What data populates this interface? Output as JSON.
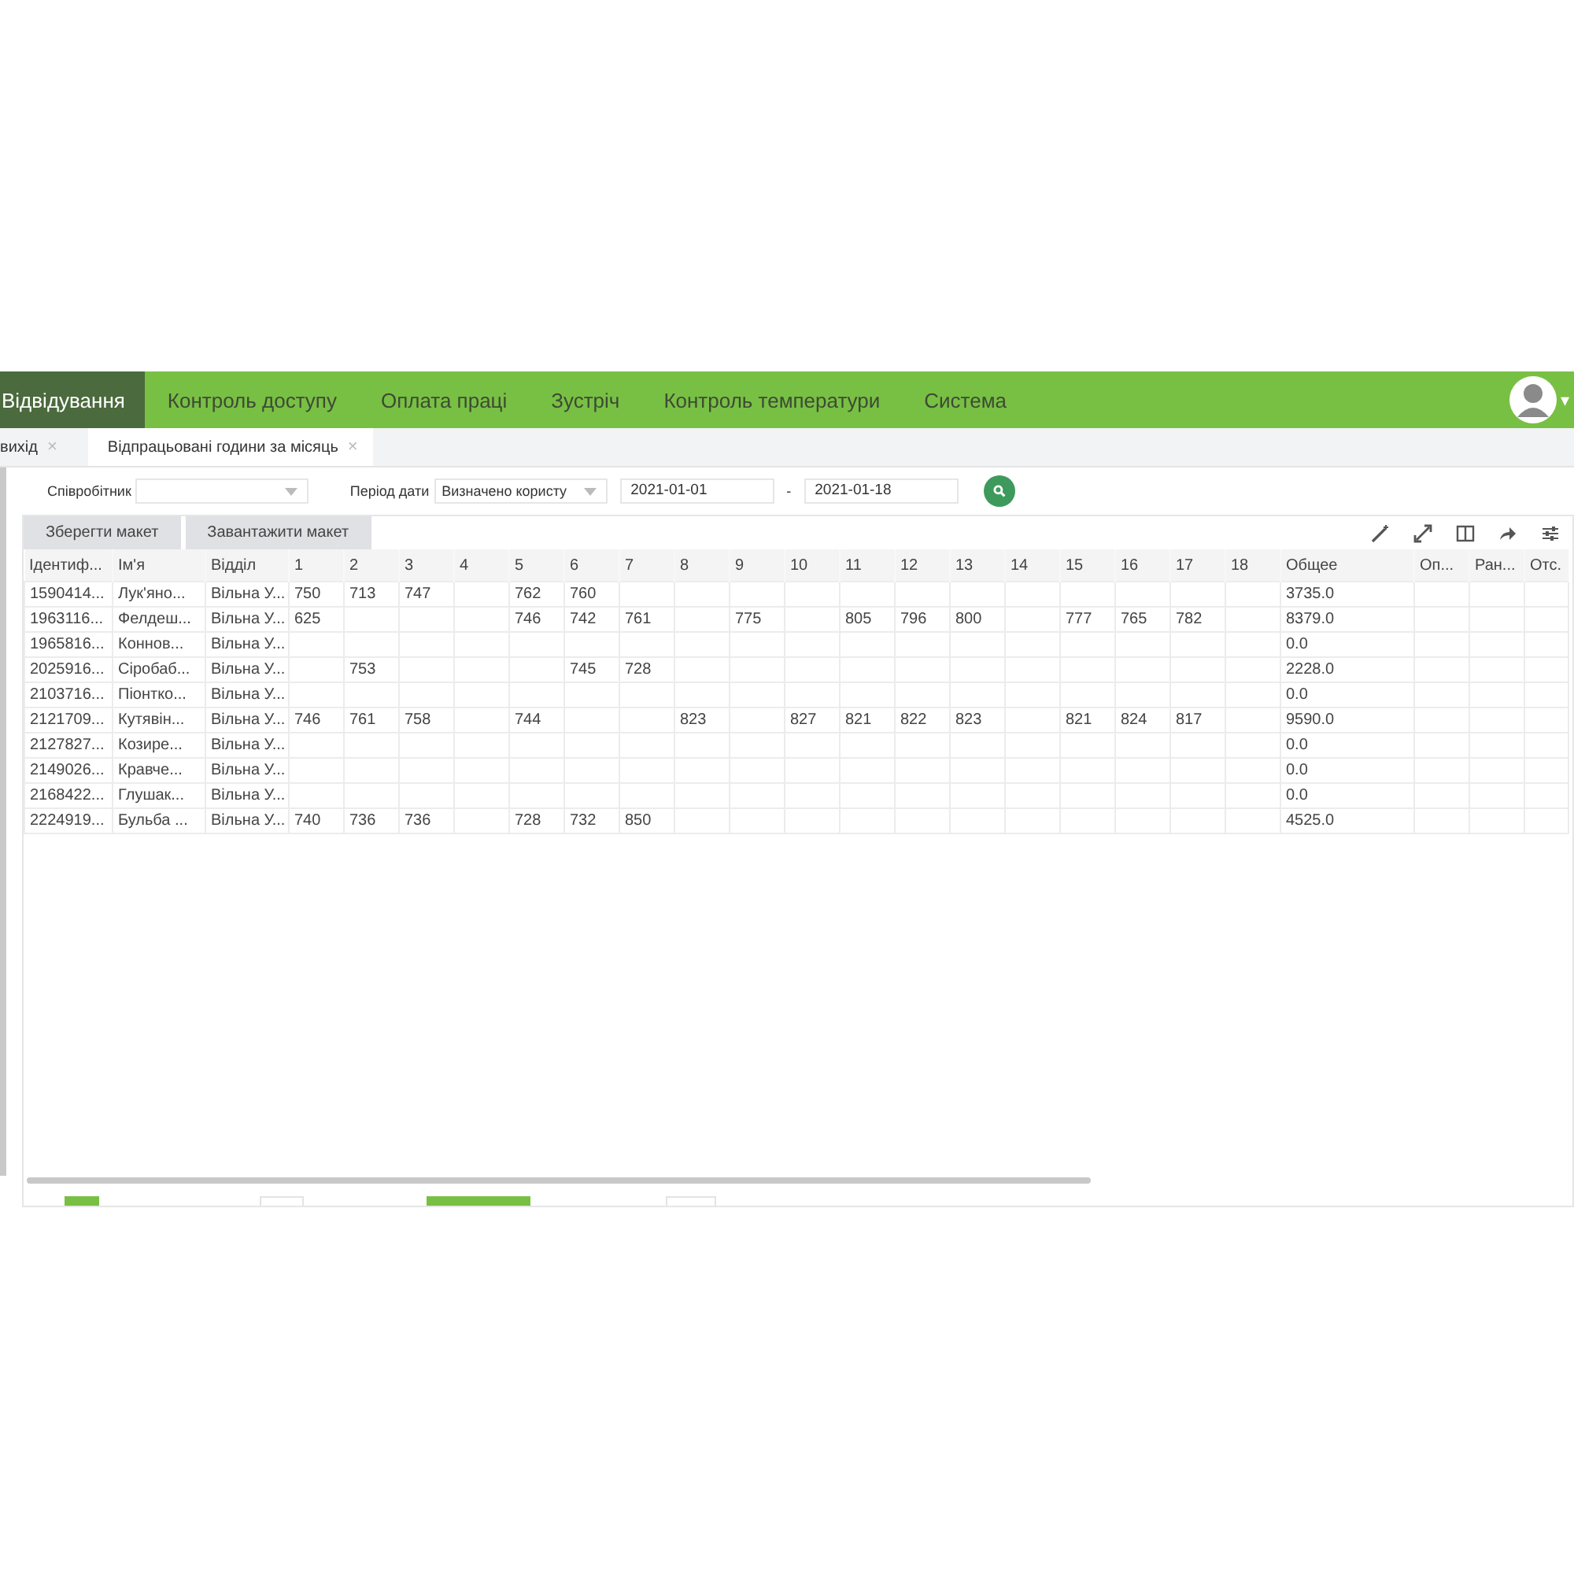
{
  "nav": {
    "items": [
      {
        "label": "Відвідування",
        "selected": true
      },
      {
        "label": "Контроль доступу",
        "selected": false
      },
      {
        "label": "Оплата праці",
        "selected": false
      },
      {
        "label": "Зустріч",
        "selected": false
      },
      {
        "label": "Контроль температури",
        "selected": false
      },
      {
        "label": "Система",
        "selected": false
      }
    ],
    "user_menu_caret": "▾"
  },
  "tabs": [
    {
      "label": "вихід",
      "close": "×",
      "selected": false
    },
    {
      "label": "Відпрацьовані години за місяць",
      "close": "×",
      "selected": true
    }
  ],
  "filters": {
    "employee": {
      "label": "Співробітник"
    },
    "period": {
      "label": "Період дати",
      "value": "Визначено користу"
    },
    "date_from": "2021-01-01",
    "separator": "-",
    "date_to": "2021-01-18"
  },
  "toolbar": {
    "buttons": [
      "Зберегти макет",
      "Завантажити макет"
    ]
  },
  "table": {
    "columns": [
      "Ідентиф...",
      "Ім'я",
      "Відділ",
      "1",
      "2",
      "3",
      "4",
      "5",
      "6",
      "7",
      "8",
      "9",
      "10",
      "11",
      "12",
      "13",
      "14",
      "15",
      "16",
      "17",
      "18",
      "Общее",
      "Оп...",
      "Ран...",
      "Отс."
    ],
    "rows": [
      {
        "cells": [
          "1590414...",
          "Лук'яно...",
          "Вільна У...",
          "750",
          "713",
          "747",
          null,
          "762",
          "760",
          null,
          null,
          null,
          null,
          null,
          null,
          null,
          null,
          null,
          null,
          null,
          null,
          "3735.0",
          null,
          null,
          null
        ]
      },
      {
        "cells": [
          "1963116...",
          "Фелдеш...",
          "Вільна У...",
          "625",
          null,
          null,
          null,
          "746",
          "742",
          "761",
          null,
          "775",
          null,
          "805",
          "796",
          "800",
          null,
          "777",
          "765",
          "782",
          null,
          "8379.0",
          null,
          null,
          null
        ]
      },
      {
        "cells": [
          "1965816...",
          "Коннов...",
          "Вільна У...",
          null,
          null,
          null,
          null,
          null,
          null,
          null,
          null,
          null,
          null,
          null,
          null,
          null,
          null,
          null,
          null,
          null,
          null,
          "0.0",
          null,
          null,
          null
        ]
      },
      {
        "cells": [
          "2025916...",
          "Сіробаб...",
          "Вільна У...",
          null,
          "753",
          null,
          null,
          null,
          "745",
          "728",
          null,
          null,
          null,
          null,
          null,
          null,
          null,
          null,
          null,
          null,
          null,
          "2228.0",
          null,
          null,
          null
        ]
      },
      {
        "cells": [
          "2103716...",
          "Піонтко...",
          "Вільна У...",
          null,
          null,
          null,
          null,
          null,
          null,
          null,
          null,
          null,
          null,
          null,
          null,
          null,
          null,
          null,
          null,
          null,
          null,
          "0.0",
          null,
          null,
          null
        ]
      },
      {
        "cells": [
          "2121709...",
          "Кутявін...",
          "Вільна У...",
          "746",
          "761",
          "758",
          null,
          "744",
          null,
          null,
          "823",
          null,
          "827",
          "821",
          "822",
          "823",
          null,
          "821",
          "824",
          "817",
          null,
          "9590.0",
          null,
          null,
          null
        ]
      },
      {
        "cells": [
          "2127827...",
          "Козире...",
          "Вільна У...",
          null,
          null,
          null,
          null,
          null,
          null,
          null,
          null,
          null,
          null,
          null,
          null,
          null,
          null,
          null,
          null,
          null,
          null,
          "0.0",
          null,
          null,
          null
        ]
      },
      {
        "cells": [
          "2149026...",
          "Кравче...",
          "Вільна У...",
          null,
          null,
          null,
          null,
          null,
          null,
          null,
          null,
          null,
          null,
          null,
          null,
          null,
          null,
          null,
          null,
          null,
          null,
          "0.0",
          null,
          null,
          null
        ]
      },
      {
        "cells": [
          "2168422...",
          "Глушак...",
          "Вільна У...",
          null,
          null,
          null,
          null,
          null,
          null,
          null,
          null,
          null,
          null,
          null,
          null,
          null,
          null,
          null,
          null,
          null,
          null,
          "0.0",
          null,
          null,
          null
        ]
      },
      {
        "cells": [
          "2224919...",
          "Бульба ...",
          "Вільна У...",
          "740",
          "736",
          "736",
          null,
          "728",
          "732",
          "850",
          null,
          null,
          null,
          null,
          null,
          null,
          null,
          null,
          null,
          null,
          null,
          "4525.0",
          null,
          null,
          null
        ]
      }
    ]
  }
}
